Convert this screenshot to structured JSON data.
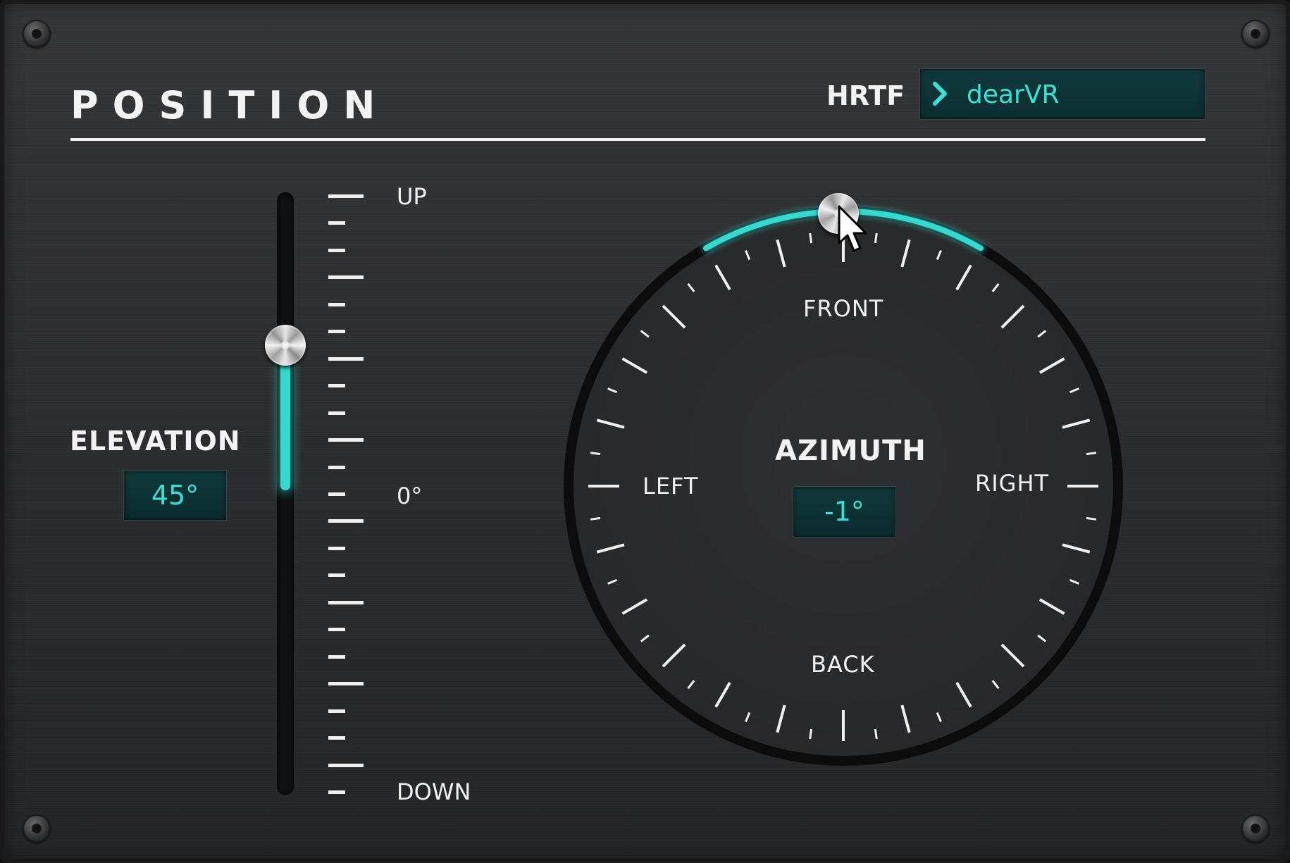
{
  "header": {
    "title": "POSITION"
  },
  "hrtf": {
    "label": "HRTF",
    "value": "dearVR"
  },
  "elevation": {
    "label": "ELEVATION",
    "value": "45°",
    "value_deg": 45,
    "range_deg": [
      -90,
      90
    ],
    "scale": {
      "up": "UP",
      "zero": "0°",
      "down": "DOWN"
    }
  },
  "azimuth": {
    "label": "AZIMUTH",
    "value": "-1°",
    "value_deg": -1,
    "directions": {
      "front": "FRONT",
      "back": "BACK",
      "left": "LEFT",
      "right": "RIGHT"
    }
  },
  "colors": {
    "accent": "#35d9cf",
    "accent_text": "#38e0d5",
    "readout_bg": "#0d3335",
    "panel_bg": "#2b2c2e",
    "text": "#f2f2f2"
  },
  "icons": [
    "chevron-right-icon",
    "mouse-pointer-icon",
    "screw-icon"
  ]
}
